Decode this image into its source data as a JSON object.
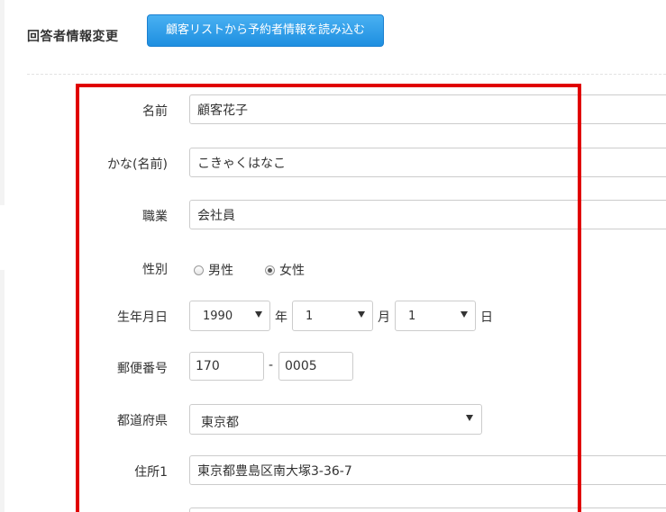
{
  "header": {
    "title": "回答者情報変更",
    "load_button_label": "顧客リストから予約者情報を読み込む"
  },
  "form": {
    "name": {
      "label": "名前",
      "value": "顧客花子"
    },
    "kana": {
      "label": "かな(名前)",
      "value": "こきゃくはなこ"
    },
    "occupation": {
      "label": "職業",
      "value": "会社員"
    },
    "gender": {
      "label": "性別",
      "options": [
        {
          "label": "男性",
          "checked": false
        },
        {
          "label": "女性",
          "checked": true
        }
      ]
    },
    "birthdate": {
      "label": "生年月日",
      "year": "1990",
      "year_unit": "年",
      "month": "1",
      "month_unit": "月",
      "day": "1",
      "day_unit": "日"
    },
    "postal": {
      "label": "郵便番号",
      "part1": "170",
      "separator": "-",
      "part2": "0005"
    },
    "prefecture": {
      "label": "都道府県",
      "value": "東京都"
    },
    "address1": {
      "label": "住所1",
      "value": "東京都豊島区南大塚3-36-7"
    }
  },
  "colors": {
    "highlight_border": "#e00000",
    "button_blue": "#1e8fe0"
  }
}
